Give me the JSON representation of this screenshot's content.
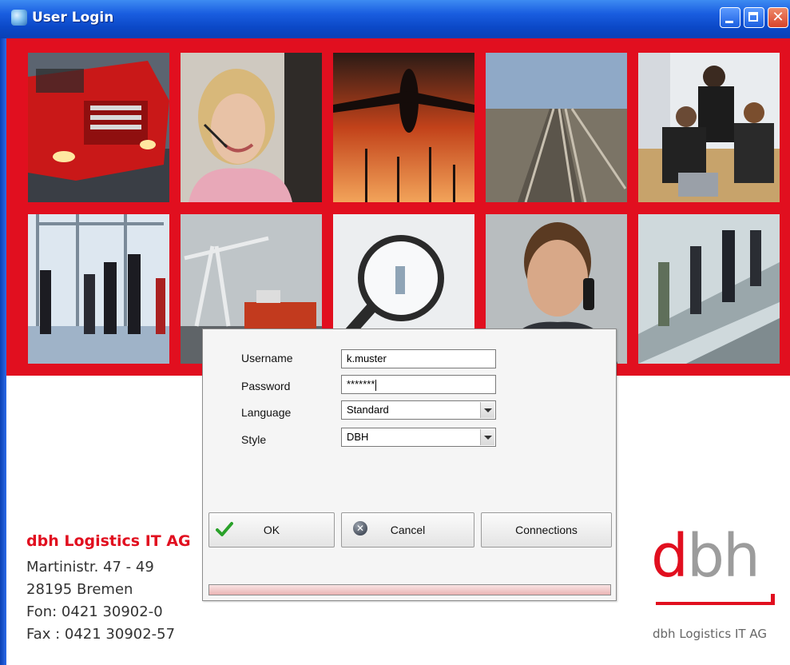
{
  "window": {
    "title": "User Login",
    "close_symbol": "✕"
  },
  "banner": {
    "background_color": "#e10f1f",
    "tiles": [
      {
        "subject": "red-truck"
      },
      {
        "subject": "woman-headset"
      },
      {
        "subject": "airplane-sunset"
      },
      {
        "subject": "railway-tracks"
      },
      {
        "subject": "office-meeting"
      },
      {
        "subject": "people-walking"
      },
      {
        "subject": "port-crane"
      },
      {
        "subject": "magnifier-keyboard"
      },
      {
        "subject": "man-phone"
      },
      {
        "subject": "escalator-people"
      }
    ]
  },
  "company": {
    "name": "dbh Logistics IT AG",
    "street": "Martinistr. 47 - 49",
    "city": "28195 Bremen",
    "phone": "Fon: 0421 30902-0",
    "fax": "Fax : 0421 30902-57"
  },
  "logo": {
    "d": "d",
    "bh": "bh",
    "caption": "dbh Logistics IT AG",
    "accent_color": "#e10f1f"
  },
  "dialog": {
    "username_label": "Username",
    "username_value": "k.muster",
    "password_label": "Password",
    "password_value": "*******",
    "language_label": "Language",
    "language_value": "Standard",
    "style_label": "Style",
    "style_value": "DBH",
    "ok_label": "OK",
    "cancel_label": "Cancel",
    "cancel_icon_glyph": "✕",
    "connections_label": "Connections"
  }
}
